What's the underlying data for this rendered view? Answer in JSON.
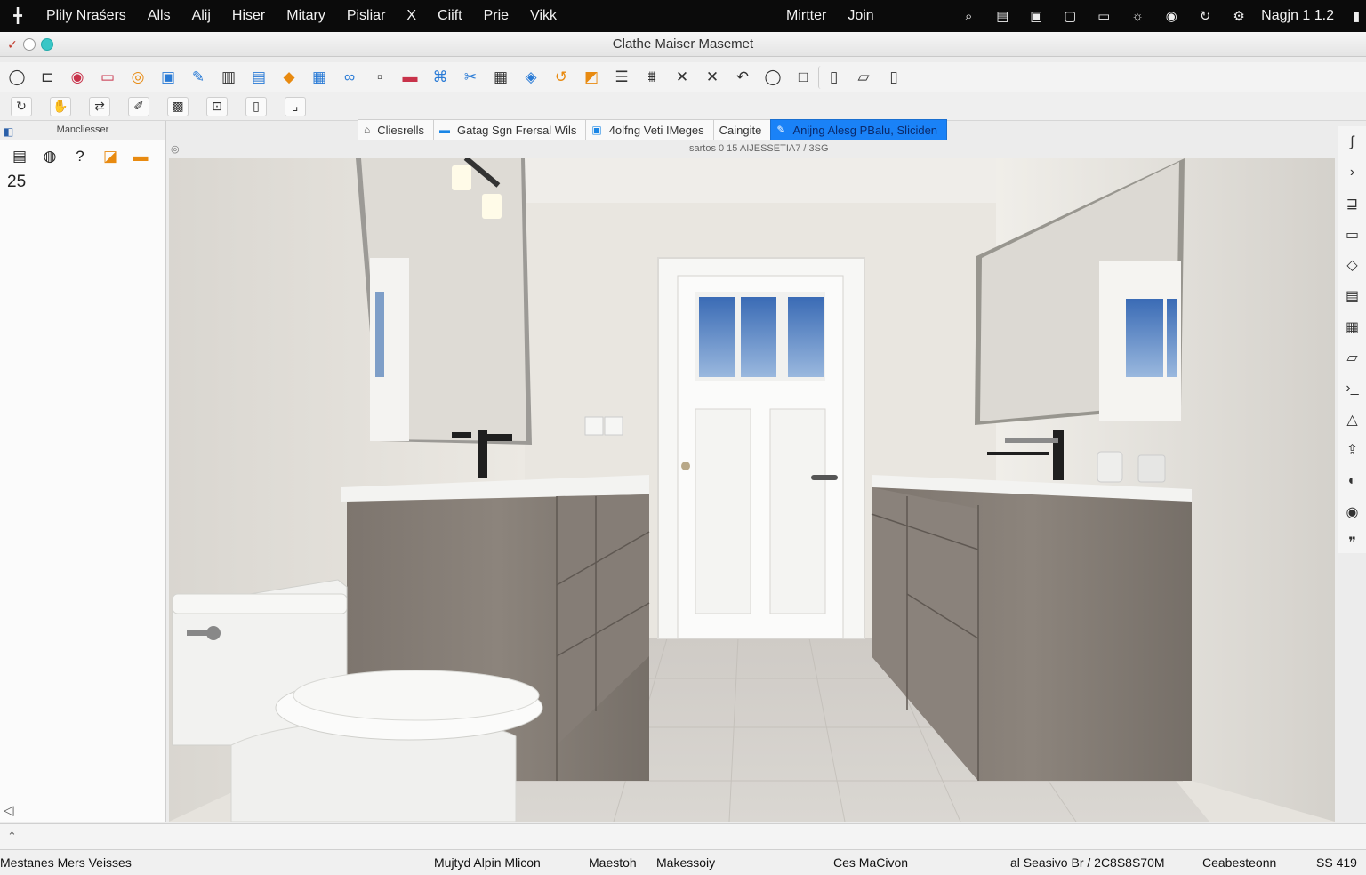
{
  "menubar": {
    "items": [
      "Plily Nraśers",
      "Alls",
      "Alij",
      "Hiser",
      "Mitary",
      "Pisliar",
      "X",
      "Ciift",
      "Prie",
      "Vikk"
    ],
    "center_items": [
      "Mirtter",
      "Join"
    ],
    "clock": "Nagjn 1 1.2"
  },
  "window": {
    "title": "Clathe Maiser Masemet"
  },
  "left_panel": {
    "header": "Mancliesser",
    "count": "25"
  },
  "tabs": [
    {
      "label": "Cliesrells"
    },
    {
      "label": "Gatag Sgn Frersal Wils"
    },
    {
      "label": "4olfng Veti IMeges"
    },
    {
      "label": "Caingite"
    },
    {
      "label": "Anijng Alesg PBalu,  Sliciden"
    }
  ],
  "canvas": {
    "caption": "sartos 0 15 AIJESSETIA7 / 3SG"
  },
  "statusbar": {
    "left": "Mestanes Mers Veisses",
    "mid1": "Mujtyd Alpin Mlicon",
    "mid2": "Maestoh",
    "mid3": "Makessoiy",
    "mid4": "Ces MaCivon",
    "right1": "al Seasivo Br / 2C8S8S70M",
    "right2": "Ceabesteonn",
    "right3": "SS 419"
  },
  "icons": {
    "menu_left": "app-menu-icon",
    "status": [
      "search-icon",
      "display-icon",
      "window-icon",
      "square-icon",
      "screen-icon",
      "brightness-icon",
      "wifi-icon",
      "refresh-icon",
      "gear-icon",
      "battery-icon"
    ]
  },
  "colors": {
    "menubar_bg": "#0b0b0b",
    "active_tab": "#1a82f7",
    "accent_teal": "#39c6c6"
  }
}
